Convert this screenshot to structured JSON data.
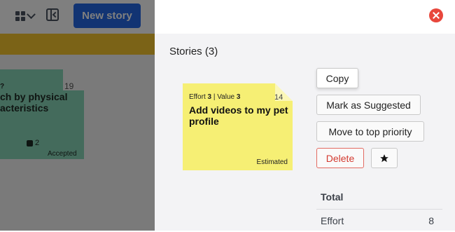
{
  "toolbar": {
    "new_story_label": "New story"
  },
  "background_card": {
    "question_mark": "?",
    "number": "19",
    "title": "ch by physical\nacteristics",
    "count": "2",
    "status": "Accepted"
  },
  "panel": {
    "title": "Stories (3)",
    "story": {
      "effort_label": "Effort",
      "effort_value": "3",
      "separator": "|",
      "value_label": "Value",
      "value_value": "3",
      "number": "14",
      "title": "Add videos to my pet profile",
      "status": "Estimated"
    },
    "actions": {
      "copy": "Copy",
      "mark_suggested": "Mark as Suggested",
      "move_top": "Move to top priority",
      "delete": "Delete"
    },
    "totals": {
      "header": "Total",
      "rows": [
        {
          "label": "Effort",
          "value": "8"
        }
      ]
    }
  },
  "colors": {
    "primary": "#2469e6",
    "danger": "#e8473c",
    "sticky_yellow": "#f6ef74",
    "sticky_green": "#89d6b8",
    "strip_yellow": "#f7c72f"
  },
  "icons": [
    "grid-icon",
    "chevron-down-icon",
    "collapse-sidebar-icon",
    "close-icon",
    "star-icon",
    "checkbox-icon"
  ]
}
